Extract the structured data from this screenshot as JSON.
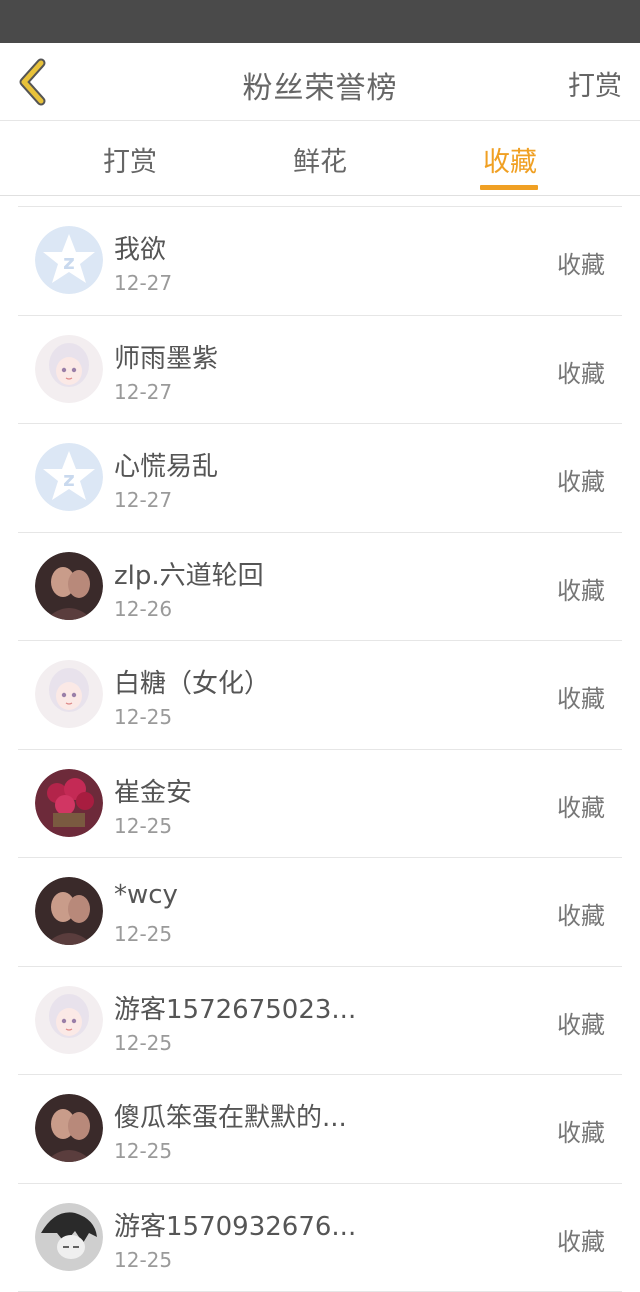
{
  "nav": {
    "title": "粉丝荣誉榜",
    "action_label": "打赏"
  },
  "colors": {
    "accent": "#f0a023",
    "status_bar": "#4a4a4a",
    "back_chevron": "#e8c23a"
  },
  "tabs": [
    {
      "label": "打赏",
      "active": false
    },
    {
      "label": "鲜花",
      "active": false
    },
    {
      "label": "收藏",
      "active": true
    }
  ],
  "fans": [
    {
      "name": "我欲",
      "date": "12-27",
      "action": "收藏",
      "avatar": "default-qq-avatar"
    },
    {
      "name": "师雨墨紫",
      "date": "12-27",
      "action": "收藏",
      "avatar": "anime-girl-avatar"
    },
    {
      "name": "心慌易乱",
      "date": "12-27",
      "action": "收藏",
      "avatar": "default-qq-avatar"
    },
    {
      "name": "zlp.六道轮回",
      "date": "12-26",
      "action": "收藏",
      "avatar": "photo-avatar"
    },
    {
      "name": "白糖（女化）",
      "date": "12-25",
      "action": "收藏",
      "avatar": "anime-girl-avatar"
    },
    {
      "name": "崔金安",
      "date": "12-25",
      "action": "收藏",
      "avatar": "flower-basket-avatar"
    },
    {
      "name": "*wcy",
      "date": "12-25",
      "action": "收藏",
      "avatar": "photo-avatar"
    },
    {
      "name": "游客1572675023...",
      "date": "12-25",
      "action": "收藏",
      "avatar": "anime-girl-avatar"
    },
    {
      "name": "傻瓜笨蛋在默默的...",
      "date": "12-25",
      "action": "收藏",
      "avatar": "photo-avatar"
    },
    {
      "name": "游客1570932676...",
      "date": "12-25",
      "action": "收藏",
      "avatar": "sketch-avatar"
    }
  ]
}
